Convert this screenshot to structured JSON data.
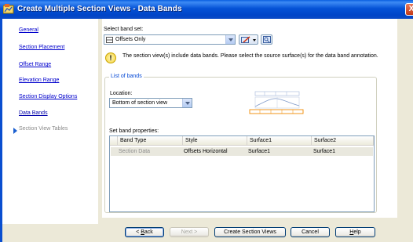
{
  "window": {
    "title": "Create Multiple Section Views - Data Bands",
    "close_glyph": "X"
  },
  "sidebar": {
    "items": [
      {
        "label": "General",
        "state": "link"
      },
      {
        "label": "Section Placement",
        "state": "link"
      },
      {
        "label": "Offset Range",
        "state": "link"
      },
      {
        "label": "Elevation Range",
        "state": "link"
      },
      {
        "label": "Section Display Options",
        "state": "link"
      },
      {
        "label": "Data Bands",
        "state": "current"
      },
      {
        "label": "Section View Tables",
        "state": "disabled"
      }
    ]
  },
  "main": {
    "band_set_label": "Select band set:",
    "band_set_value": "Offsets Only",
    "info_text": "The section view(s) include data bands. Please select the source surface(s) for the data band annotation.",
    "info_glyph": "!",
    "list_group_title": "List of bands",
    "location_label": "Location:",
    "location_value": "Bottom of section view",
    "set_band_properties_label": "Set band properties:",
    "table": {
      "columns": [
        "Band Type",
        "Style",
        "Surface1",
        "Surface2"
      ],
      "rows": [
        {
          "band_type": "Section Data",
          "style": "Offsets Horizontal",
          "surface1": "Surface1",
          "surface2": "Surface1"
        }
      ]
    }
  },
  "footer": {
    "back": {
      "prefix": "< ",
      "key": "B",
      "rest": "ack"
    },
    "next": "Next >",
    "create": "Create Section Views",
    "cancel": "Cancel",
    "help": {
      "key": "H",
      "rest": "elp"
    }
  }
}
